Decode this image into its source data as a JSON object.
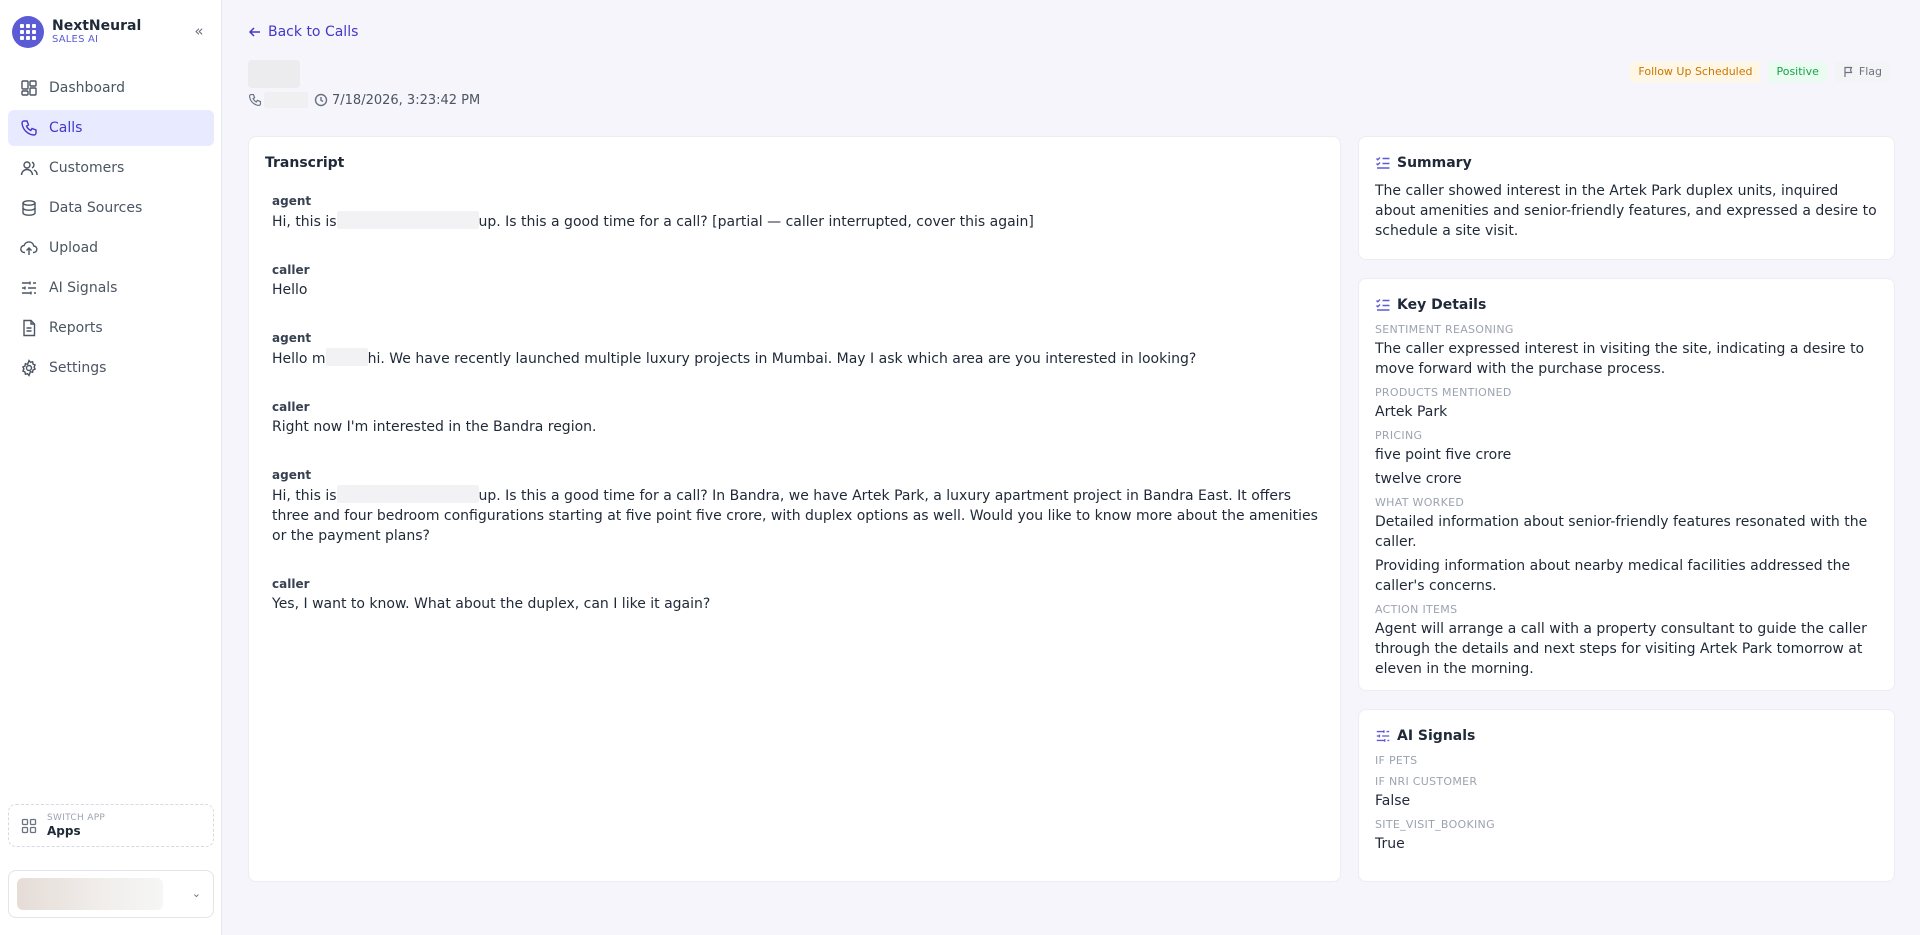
{
  "app": {
    "name": "NextNeural",
    "subtitle": "SALES AI",
    "collapse_icon": "chevrons-left-icon"
  },
  "nav": [
    {
      "label": "Dashboard",
      "icon": "grid-icon"
    },
    {
      "label": "Calls",
      "icon": "phone-icon"
    },
    {
      "label": "Customers",
      "icon": "users-icon"
    },
    {
      "label": "Data Sources",
      "icon": "database-icon"
    },
    {
      "label": "Upload",
      "icon": "upload-cloud-icon"
    },
    {
      "label": "AI Signals",
      "icon": "sliders-icon"
    },
    {
      "label": "Reports",
      "icon": "file-text-icon"
    },
    {
      "label": "Settings",
      "icon": "gear-icon"
    }
  ],
  "switch_app": {
    "sub": "SWITCH APP",
    "label": "Apps"
  },
  "header": {
    "back_label": "Back to Calls",
    "timestamp": "7/18/2026, 3:23:42 PM",
    "badges": {
      "status": "Follow Up Scheduled",
      "sentiment": "Positive",
      "flag": "Flag"
    }
  },
  "transcript": {
    "title": "Transcript",
    "messages": [
      {
        "role": "agent",
        "pre": "Hi, this is",
        "post": "up. Is this a good time for a call? [partial — caller interrupted, cover this again]"
      },
      {
        "role": "caller",
        "text": "Hello"
      },
      {
        "role": "agent",
        "pre": "Hello m",
        "post": "hi. We have recently launched multiple luxury projects in Mumbai. May I ask which area are you interested in looking?"
      },
      {
        "role": "caller",
        "text": "Right now I'm interested in the Bandra region."
      },
      {
        "role": "agent",
        "pre": "Hi, this is",
        "post": "up. Is this a good time for a call? In Bandra, we have Artek Park, a luxury apartment project in Bandra East. It offers three and four bedroom configurations starting at five point five crore, with duplex options as well. Would you like to know more about the amenities or the payment plans?"
      },
      {
        "role": "caller",
        "text": "Yes, I want to know. What about the duplex, can I like it again?"
      }
    ]
  },
  "summary": {
    "title": "Summary",
    "text": "The caller showed interest in the Artek Park duplex units, inquired about amenities and senior-friendly features, and expressed a desire to schedule a site visit."
  },
  "key_details": {
    "title": "Key Details",
    "sentiment_label": "SENTIMENT REASONING",
    "sentiment": "The caller expressed interest in visiting the site, indicating a desire to move forward with the purchase process.",
    "products_label": "PRODUCTS MENTIONED",
    "products": "Artek Park",
    "pricing_label": "PRICING",
    "pricing": [
      "five point five crore",
      "twelve crore"
    ],
    "worked_label": "WHAT WORKED",
    "worked": [
      "Detailed information about senior-friendly features resonated with the caller.",
      "Providing information about nearby medical facilities addressed the caller's concerns."
    ],
    "actions_label": "ACTION ITEMS",
    "actions": "Agent will arrange a call with a property consultant to guide the caller through the details and next steps for visiting Artek Park tomorrow at eleven in the morning."
  },
  "ai_signals": {
    "title": "AI Signals",
    "items": [
      {
        "label": "IF PETS",
        "value": ""
      },
      {
        "label": "IF NRI CUSTOMER",
        "value": "False"
      },
      {
        "label": "SITE_VISIT_BOOKING",
        "value": "True"
      }
    ]
  },
  "colors": {
    "accent": "#4338ca",
    "brand": "#5b5bd6",
    "warning": "#c77700",
    "positive": "#16a34a"
  }
}
